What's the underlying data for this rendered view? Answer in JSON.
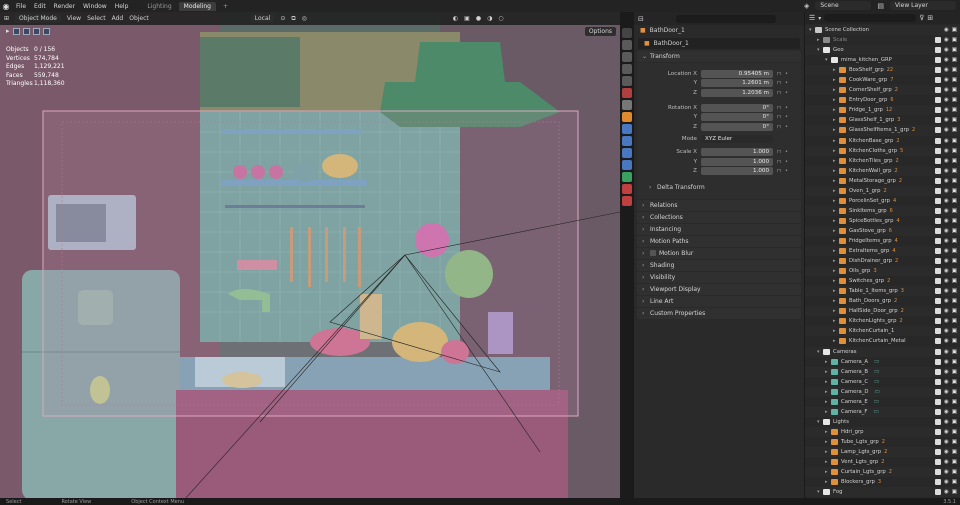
{
  "menubar": {
    "menus": [
      "File",
      "Edit",
      "Render",
      "Window",
      "Help"
    ],
    "workspaces": [
      {
        "label": "Lighting",
        "active": false
      },
      {
        "label": "Modeling",
        "active": true
      }
    ],
    "add_tab": "+",
    "scene": "Scene",
    "view_layer": "View Layer"
  },
  "viewport": {
    "mode": "Object Mode",
    "menus": [
      "View",
      "Select",
      "Add",
      "Object"
    ],
    "orientation": "Local",
    "options_label": "Options",
    "stats": [
      {
        "key": "Objects",
        "value": "0 / 156"
      },
      {
        "key": "Vertices",
        "value": "574,784"
      },
      {
        "key": "Edges",
        "value": "1,129,221"
      },
      {
        "key": "Faces",
        "value": "559,748"
      },
      {
        "key": "Triangles",
        "value": "1,118,360"
      }
    ]
  },
  "status_bar": {
    "select": "Select",
    "rotate": "Rotate View",
    "context": "Object Context Menu",
    "version": "3.5.1"
  },
  "properties": {
    "object_crumb": "BathDoor_1",
    "object_name": "BathDoor_1",
    "transform_title": "Transform",
    "location": {
      "label": "Location X",
      "x": "0.95405 m",
      "y": "1.2601 m",
      "z": "1.2036 m"
    },
    "rotation": {
      "label": "Rotation X",
      "x": "0°",
      "y": "0°",
      "z": "0°"
    },
    "mode_label": "Mode",
    "mode_value": "XYZ Euler",
    "scale": {
      "label": "Scale X",
      "x": "1.000",
      "y": "1.000",
      "z": "1.000"
    },
    "axis_y": "Y",
    "axis_z": "Z",
    "delta_transform": "Delta Transform",
    "panels": [
      "Relations",
      "Collections",
      "Instancing",
      "Motion Paths",
      "Motion Blur",
      "Shading",
      "Visibility",
      "Viewport Display",
      "Line Art",
      "Custom Properties"
    ]
  },
  "outliner": {
    "rows": [
      {
        "name": "Scene Collection",
        "indent": 0,
        "kind": "scene"
      },
      {
        "name": "Scale",
        "indent": 1,
        "kind": "coll-dim"
      },
      {
        "name": "Geo",
        "indent": 1,
        "kind": "coll"
      },
      {
        "name": "mima_kitchen_GRP",
        "indent": 2,
        "kind": "coll"
      },
      {
        "name": "BoxShelf_grp",
        "indent": 3,
        "kind": "obj",
        "badge": "22"
      },
      {
        "name": "CookWare_grp",
        "indent": 3,
        "kind": "obj",
        "badge": "7"
      },
      {
        "name": "CornerShelf_grp",
        "indent": 3,
        "kind": "obj",
        "badge": "2"
      },
      {
        "name": "EntryDoor_grp",
        "indent": 3,
        "kind": "obj",
        "badge": "6"
      },
      {
        "name": "Fridge_1_grp",
        "indent": 3,
        "kind": "obj",
        "badge": "12"
      },
      {
        "name": "GlassShelf_1_grp",
        "indent": 3,
        "kind": "obj",
        "badge": "3"
      },
      {
        "name": "GlassShelfItems_1_grp",
        "indent": 3,
        "kind": "obj",
        "badge": "2"
      },
      {
        "name": "KitchenBase_grp",
        "indent": 3,
        "kind": "obj",
        "badge": "2"
      },
      {
        "name": "KitchenCloths_grp",
        "indent": 3,
        "kind": "obj",
        "badge": "5"
      },
      {
        "name": "KitchenTiles_grp",
        "indent": 3,
        "kind": "obj",
        "badge": "2"
      },
      {
        "name": "KitchenWall_grp",
        "indent": 3,
        "kind": "obj",
        "badge": "2"
      },
      {
        "name": "MetalStorage_grp",
        "indent": 3,
        "kind": "obj",
        "badge": "2"
      },
      {
        "name": "Oven_1_grp",
        "indent": 3,
        "kind": "obj",
        "badge": "2"
      },
      {
        "name": "PorcelinSet_grp",
        "indent": 3,
        "kind": "obj",
        "badge": "4"
      },
      {
        "name": "SinkItems_grp",
        "indent": 3,
        "kind": "obj",
        "badge": "6"
      },
      {
        "name": "SpiceBottles_grp",
        "indent": 3,
        "kind": "obj",
        "badge": "4"
      },
      {
        "name": "GasStove_grp",
        "indent": 3,
        "kind": "obj",
        "badge": "6"
      },
      {
        "name": "FridgeItems_grp",
        "indent": 3,
        "kind": "obj",
        "badge": "4"
      },
      {
        "name": "ExtraItems_grp",
        "indent": 3,
        "kind": "obj",
        "badge": "4"
      },
      {
        "name": "DishDrainer_grp",
        "indent": 3,
        "kind": "obj",
        "badge": "2"
      },
      {
        "name": "Oils_grp",
        "indent": 3,
        "kind": "obj",
        "badge": "3"
      },
      {
        "name": "Switches_grp",
        "indent": 3,
        "kind": "obj",
        "badge": "2"
      },
      {
        "name": "Table_1_Items_grp",
        "indent": 3,
        "kind": "obj",
        "badge": "3"
      },
      {
        "name": "Bath_Doors_grp",
        "indent": 3,
        "kind": "obj",
        "badge": "2"
      },
      {
        "name": "HallSide_Door_grp",
        "indent": 3,
        "kind": "obj",
        "badge": "2"
      },
      {
        "name": "KitchenLights_grp",
        "indent": 3,
        "kind": "obj",
        "badge": "2"
      },
      {
        "name": "KitchenCurtain_1",
        "indent": 3,
        "kind": "mesh"
      },
      {
        "name": "KitchenCurtain_Metal",
        "indent": 3,
        "kind": "mesh"
      },
      {
        "name": "Cameras",
        "indent": 1,
        "kind": "coll"
      },
      {
        "name": "Camera_A",
        "indent": 2,
        "kind": "camera"
      },
      {
        "name": "Camera_B",
        "indent": 2,
        "kind": "camera"
      },
      {
        "name": "Camera_C",
        "indent": 2,
        "kind": "camera"
      },
      {
        "name": "Camera_D",
        "indent": 2,
        "kind": "camera"
      },
      {
        "name": "Camera_E",
        "indent": 2,
        "kind": "camera"
      },
      {
        "name": "Camera_F",
        "indent": 2,
        "kind": "camera"
      },
      {
        "name": "Lights",
        "indent": 1,
        "kind": "coll"
      },
      {
        "name": "Hdri_grp",
        "indent": 2,
        "kind": "light"
      },
      {
        "name": "Tube_Lgts_grp",
        "indent": 2,
        "kind": "light",
        "badge": "2"
      },
      {
        "name": "Lamp_Lgts_grp",
        "indent": 2,
        "kind": "light",
        "badge": "2"
      },
      {
        "name": "Vent_Lgts_grp",
        "indent": 2,
        "kind": "light",
        "badge": "2"
      },
      {
        "name": "Curtain_Lgts_grp",
        "indent": 2,
        "kind": "light",
        "badge": "2"
      },
      {
        "name": "Blockers_grp",
        "indent": 2,
        "kind": "light",
        "badge": "3"
      },
      {
        "name": "Fog",
        "indent": 1,
        "kind": "coll"
      }
    ]
  },
  "colors": {
    "accent": "#4772b3",
    "object_orange": "#e0903a",
    "camera_teal": "#5fb3a4",
    "collection_white": "#dcdcdc"
  }
}
